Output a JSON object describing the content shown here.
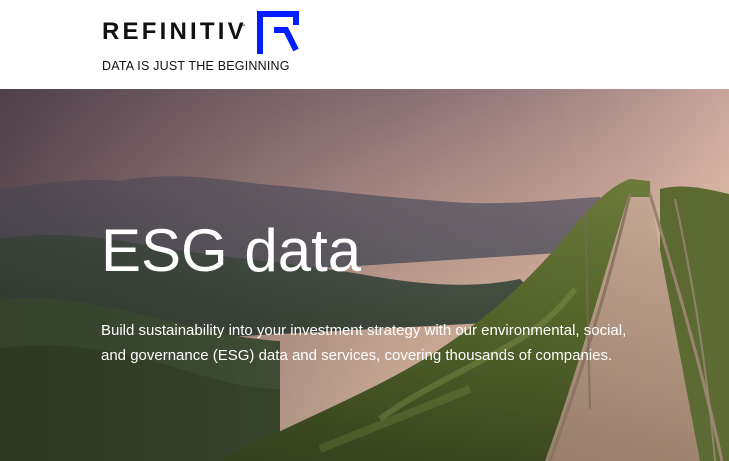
{
  "header": {
    "brand": "REFINITIV",
    "trademark": "™",
    "tagline": "DATA IS JUST THE BEGINNING",
    "logo_icon": "refinitiv-r-logo-icon",
    "logo_color": "#001EFF"
  },
  "hero": {
    "title": "ESG data",
    "description_line1": "Build sustainability into your investment strategy with our environmental, social,",
    "description_line2": "and governance (ESG) data and services, covering thousands of companies."
  }
}
